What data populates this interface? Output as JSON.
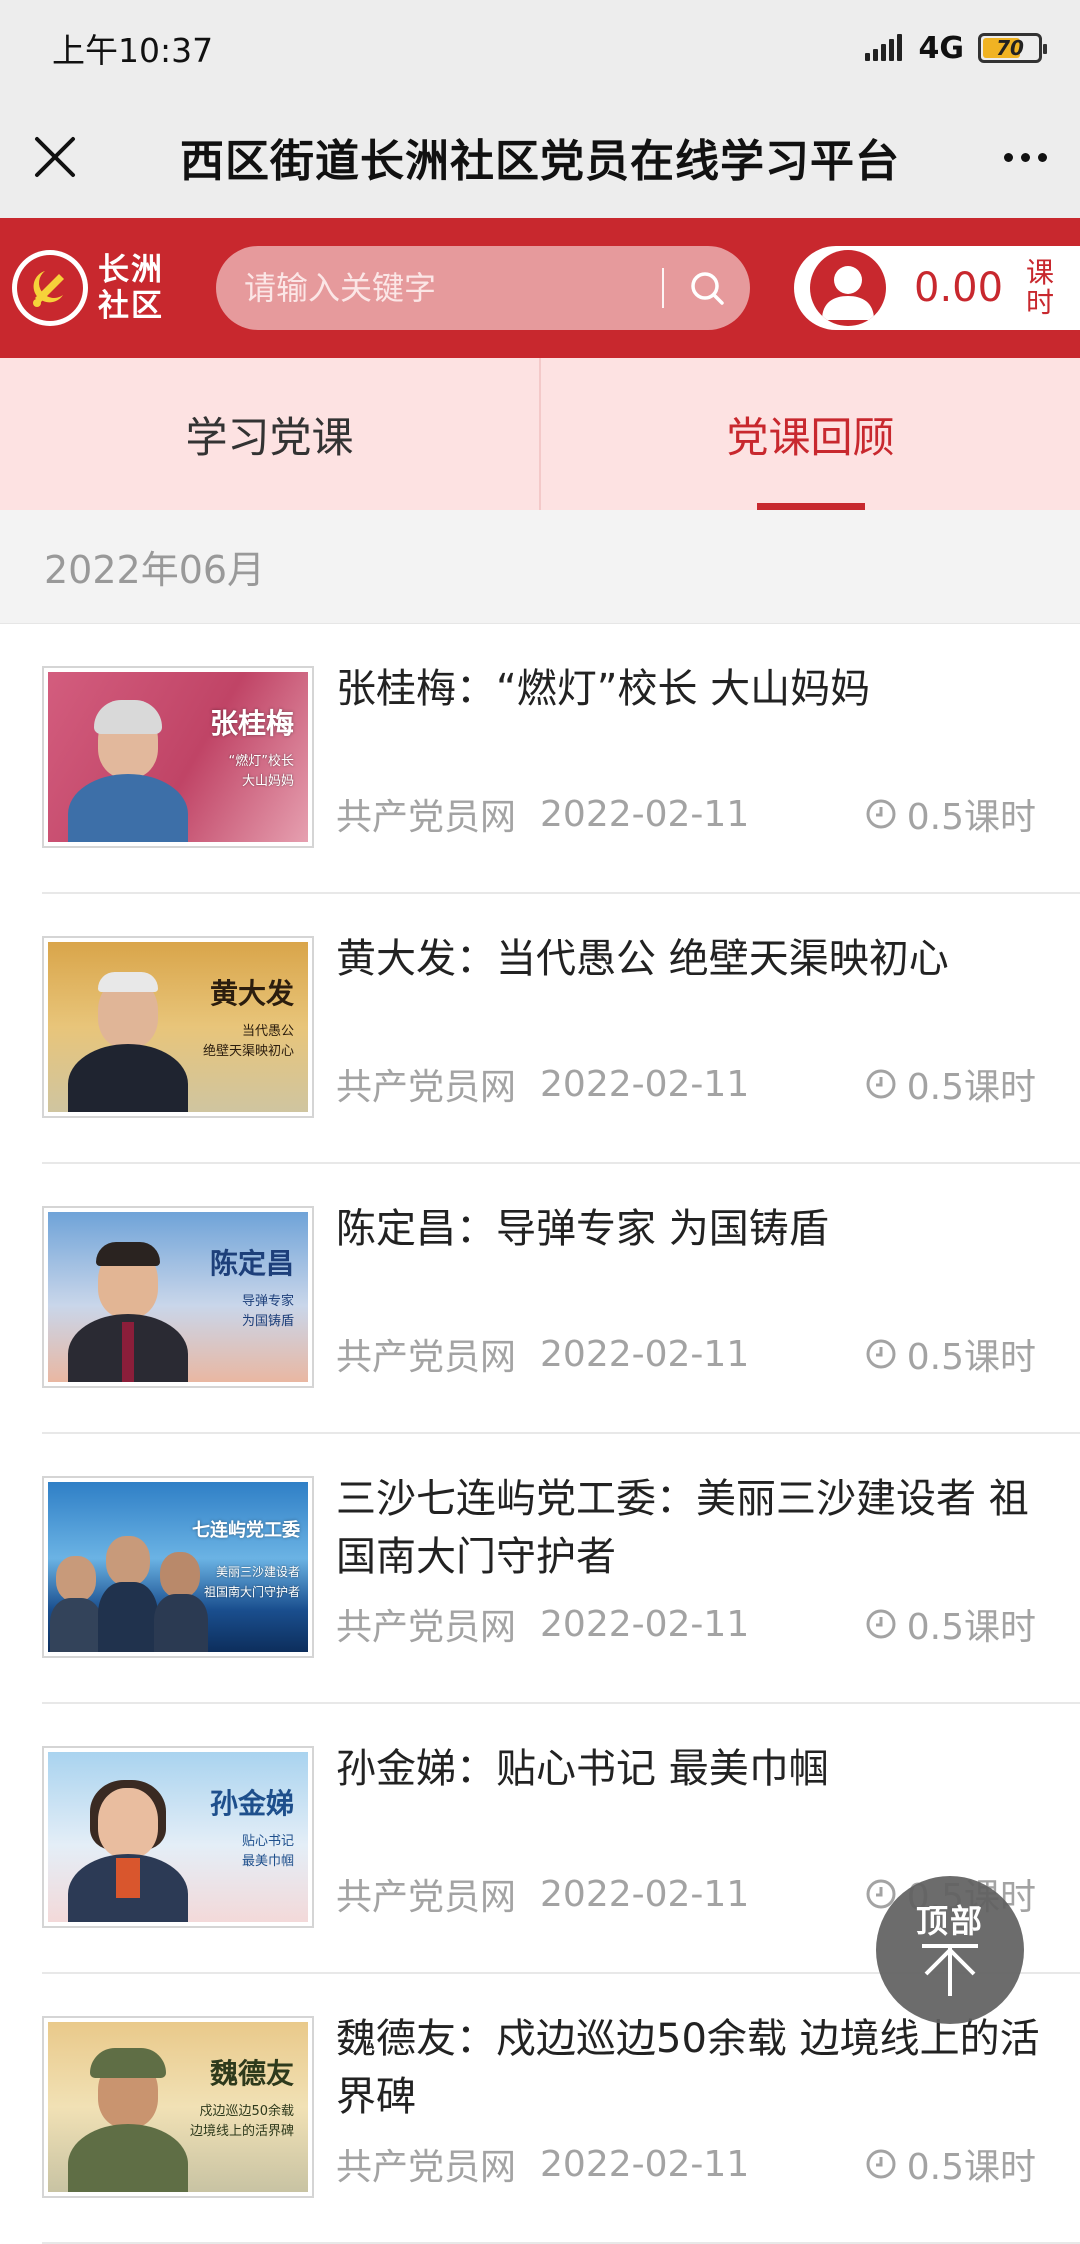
{
  "status_bar": {
    "time": "上午10:37",
    "network": "4G",
    "battery": "70",
    "battery_level": 0.7
  },
  "title_bar": {
    "title": "西区街道长洲社区党员在线学习平台"
  },
  "header": {
    "logo_text_line1": "长洲",
    "logo_text_line2": "社区",
    "search_placeholder": "请输入关键字",
    "hours_value": "0.00",
    "hours_unit": "课时",
    "brand_color": "#c8282e"
  },
  "tabs": [
    {
      "label": "学习党课",
      "active": false
    },
    {
      "label": "党课回顾",
      "active": true
    }
  ],
  "month": "2022年06月",
  "items": [
    {
      "title": "张桂梅：“燃灯”校长 大山妈妈",
      "source": "共产党员网",
      "date": "2022-02-11",
      "duration": "0.5课时",
      "thumb_name": "张桂梅",
      "thumb_sub1": "“燃灯”校长",
      "thumb_sub2": "大山妈妈"
    },
    {
      "title": "黄大发：当代愚公 绝壁天渠映初心",
      "source": "共产党员网",
      "date": "2022-02-11",
      "duration": "0.5课时",
      "thumb_name": "黄大发",
      "thumb_sub1": "当代愚公",
      "thumb_sub2": "绝壁天渠映初心"
    },
    {
      "title": "陈定昌：导弹专家 为国铸盾",
      "source": "共产党员网",
      "date": "2022-02-11",
      "duration": "0.5课时",
      "thumb_name": "陈定昌",
      "thumb_sub1": "导弹专家",
      "thumb_sub2": "为国铸盾"
    },
    {
      "title": "三沙七连屿党工委：美丽三沙建设者 祖国南大门守护者",
      "source": "共产党员网",
      "date": "2022-02-11",
      "duration": "0.5课时",
      "thumb_name": "七连屿党工委",
      "thumb_sub1": "美丽三沙建设者",
      "thumb_sub2": "祖国南大门守护者"
    },
    {
      "title": "孙金娣：贴心书记 最美巾帼",
      "source": "共产党员网",
      "date": "2022-02-11",
      "duration": "0.5课时",
      "thumb_name": "孙金娣",
      "thumb_sub1": "贴心书记",
      "thumb_sub2": "最美巾帼"
    },
    {
      "title": "魏德友：戍边巡边50余载 边境线上的活界碑",
      "source": "共产党员网",
      "date": "2022-02-11",
      "duration": "0.5课时",
      "thumb_name": "魏德友",
      "thumb_sub1": "戍边巡边50余载",
      "thumb_sub2": "边境线上的活界碑"
    }
  ],
  "back_to_top": "顶部"
}
